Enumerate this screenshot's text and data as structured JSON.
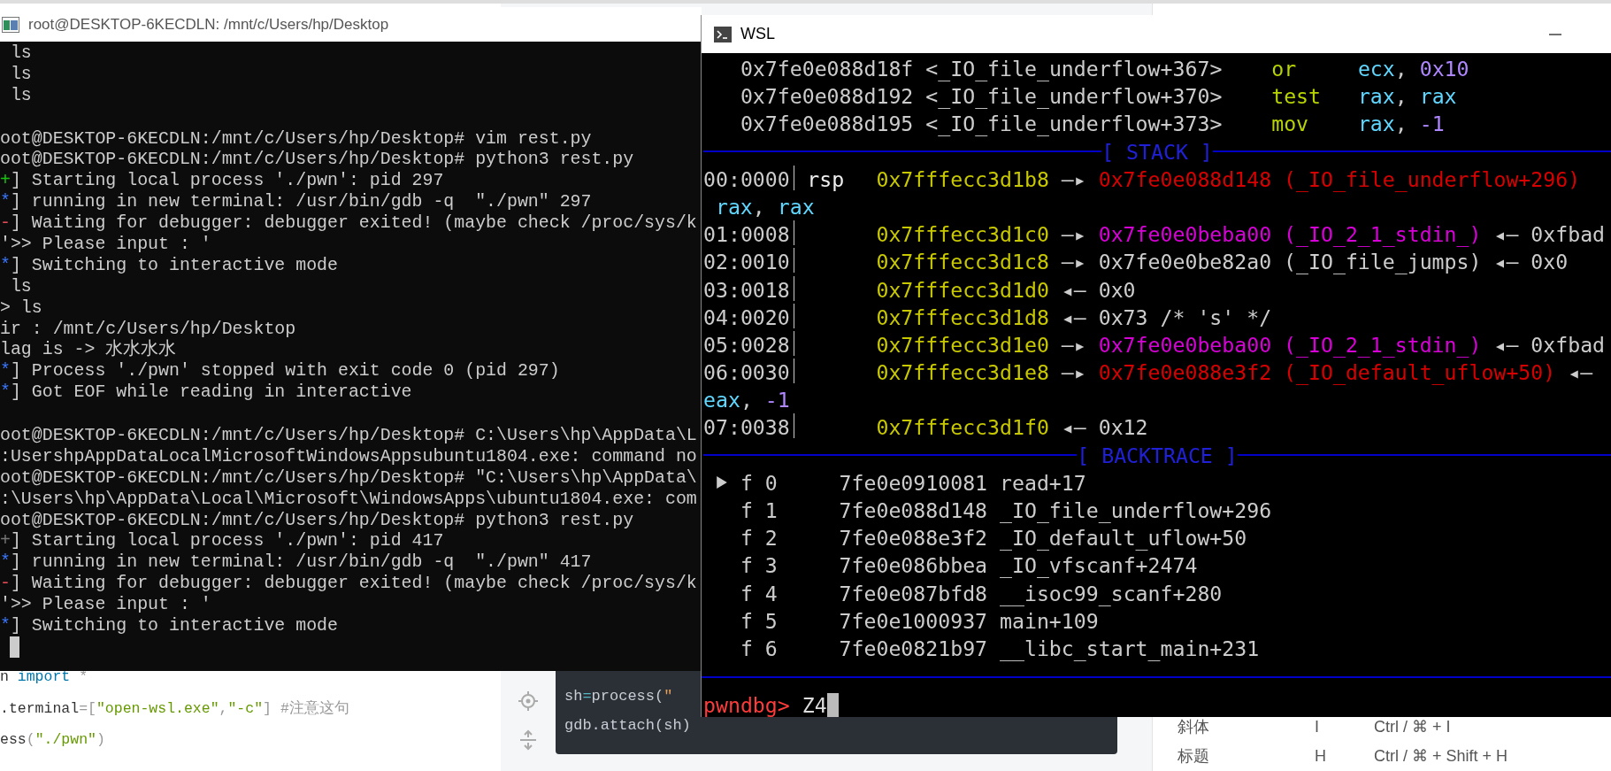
{
  "left_terminal": {
    "title": "root@DESKTOP-6KECDLN: /mnt/c/Users/hp/Desktop",
    "lines": [
      {
        "kind": "plain",
        "text": "ls",
        "indented": true
      },
      {
        "kind": "plain",
        "text": "ls",
        "indented": true
      },
      {
        "kind": "plain",
        "text": "ls",
        "indented": true
      },
      {
        "kind": "plain",
        "text": "oot@DESKTOP-6KECDLN:/mnt/c/Users/hp/Desktop# vim rest.py",
        "gap_before": true
      },
      {
        "kind": "plain",
        "text": "oot@DESKTOP-6KECDLN:/mnt/c/Users/hp/Desktop# python3 rest.py"
      },
      {
        "kind": "success",
        "text": "+] Starting local process './pwn': pid 297"
      },
      {
        "kind": "info",
        "text": "*] running in new terminal: /usr/bin/gdb -q  \"./pwn\" 297"
      },
      {
        "kind": "error",
        "text": "-] Waiting for debugger: debugger exited! (maybe check /proc/sys/k"
      },
      {
        "kind": "plain",
        "text": "'>> Please input : '"
      },
      {
        "kind": "info",
        "text": "*] Switching to interactive mode"
      },
      {
        "kind": "plain",
        "text": "ls",
        "indented": true
      },
      {
        "kind": "plain",
        "text": "> ls"
      },
      {
        "kind": "plain",
        "text": "ir : /mnt/c/Users/hp/Desktop"
      },
      {
        "kind": "plain",
        "text": "lag is -> 水水水水"
      },
      {
        "kind": "info",
        "text": "*] Process './pwn' stopped with exit code 0 (pid 297)"
      },
      {
        "kind": "info",
        "text": "*] Got EOF while reading in interactive"
      },
      {
        "kind": "plain",
        "text": "oot@DESKTOP-6KECDLN:/mnt/c/Users/hp/Desktop# C:\\Users\\hp\\AppData\\L",
        "gap_before": true
      },
      {
        "kind": "plain",
        "text": ":UsershpAppDataLocalMicrosoftWindowsAppsubuntu1804.exe: command no"
      },
      {
        "kind": "plain",
        "text": "oot@DESKTOP-6KECDLN:/mnt/c/Users/hp/Desktop# \"C:\\Users\\hp\\AppData\\"
      },
      {
        "kind": "plain",
        "text": ":\\Users\\hp\\AppData\\Local\\Microsoft\\WindowsApps\\ubuntu1804.exe: com"
      },
      {
        "kind": "plain",
        "text": "oot@DESKTOP-6KECDLN:/mnt/c/Users/hp/Desktop# python3 rest.py"
      },
      {
        "kind": "dim",
        "text": "+] Starting local process './pwn': pid 417"
      },
      {
        "kind": "info",
        "text": "*] running in new terminal: /usr/bin/gdb -q  \"./pwn\" 417"
      },
      {
        "kind": "error",
        "text": "-] Waiting for debugger: debugger exited! (maybe check /proc/sys/k"
      },
      {
        "kind": "plain",
        "text": "'>> Please input : '"
      },
      {
        "kind": "info",
        "text": "*] Switching to interactive mode"
      }
    ]
  },
  "wsl_terminal": {
    "title": "WSL",
    "disassembly": [
      {
        "address": "0x7fe0e088d18f",
        "symbol": "<_IO_file_underflow+367>",
        "mnemonic": "or",
        "operands": [
          {
            "text": "ecx",
            "kind": "register"
          },
          {
            "text": ", ",
            "kind": "plain"
          },
          {
            "text": "0x10",
            "kind": "number"
          }
        ]
      },
      {
        "address": "0x7fe0e088d192",
        "symbol": "<_IO_file_underflow+370>",
        "mnemonic": "test",
        "operands": [
          {
            "text": "rax",
            "kind": "register"
          },
          {
            "text": ", ",
            "kind": "plain"
          },
          {
            "text": "rax",
            "kind": "register"
          }
        ]
      },
      {
        "address": "0x7fe0e088d195",
        "symbol": "<_IO_file_underflow+373>",
        "mnemonic": "mov",
        "operands": [
          {
            "text": "rax",
            "kind": "register"
          },
          {
            "text": ", ",
            "kind": "plain"
          },
          {
            "text": "-1",
            "kind": "number"
          }
        ]
      }
    ],
    "stack_title": "[ STACK ]",
    "stack": [
      {
        "kind": "entry",
        "offset": "00:0000",
        "register": "rsp",
        "address": "0x7fffecc3d1b8",
        "chain": [
          {
            "text": "—▸",
            "kind": "arrow"
          },
          {
            "text": "0x7fe0e088d148 (_IO_file_underflow+296)",
            "kind": "code"
          }
        ]
      },
      {
        "kind": "wrap",
        "indented": true,
        "chain": [
          {
            "text": "rax",
            "kind": "register"
          },
          {
            "text": ", ",
            "kind": "plain"
          },
          {
            "text": "rax",
            "kind": "register"
          }
        ]
      },
      {
        "kind": "entry",
        "offset": "01:0008",
        "address": "0x7fffecc3d1c0",
        "chain": [
          {
            "text": "—▸",
            "kind": "arrow"
          },
          {
            "text": "0x7fe0e0beba00 (_IO_2_1_stdin_)",
            "kind": "data"
          },
          {
            "text": "◂—",
            "kind": "arrow"
          },
          {
            "text": "0xfbad",
            "kind": "plain"
          }
        ]
      },
      {
        "kind": "entry",
        "offset": "02:0010",
        "address": "0x7fffecc3d1c8",
        "chain": [
          {
            "text": "—▸",
            "kind": "arrow"
          },
          {
            "text": "0x7fe0e0be82a0 (_IO_file_jumps)",
            "kind": "plain"
          },
          {
            "text": "◂—",
            "kind": "arrow"
          },
          {
            "text": "0x0",
            "kind": "plain"
          }
        ]
      },
      {
        "kind": "entry",
        "offset": "03:0018",
        "address": "0x7fffecc3d1d0",
        "chain": [
          {
            "text": "◂—",
            "kind": "arrow"
          },
          {
            "text": "0x0",
            "kind": "plain"
          }
        ]
      },
      {
        "kind": "entry",
        "offset": "04:0020",
        "address": "0x7fffecc3d1d8",
        "chain": [
          {
            "text": "◂—",
            "kind": "arrow"
          },
          {
            "text": "0x73 /* 's' */",
            "kind": "plain"
          }
        ]
      },
      {
        "kind": "entry",
        "offset": "05:0028",
        "address": "0x7fffecc3d1e0",
        "chain": [
          {
            "text": "—▸",
            "kind": "arrow"
          },
          {
            "text": "0x7fe0e0beba00 (_IO_2_1_stdin_)",
            "kind": "data"
          },
          {
            "text": "◂—",
            "kind": "arrow"
          },
          {
            "text": "0xfbad",
            "kind": "plain"
          }
        ]
      },
      {
        "kind": "entry",
        "offset": "06:0030",
        "address": "0x7fffecc3d1e8",
        "chain": [
          {
            "text": "—▸",
            "kind": "arrow"
          },
          {
            "text": "0x7fe0e088e3f2 (_IO_default_uflow+50)",
            "kind": "code"
          },
          {
            "text": "◂—",
            "kind": "arrow"
          }
        ]
      },
      {
        "kind": "wrap",
        "indented": false,
        "chain": [
          {
            "text": "eax",
            "kind": "register"
          },
          {
            "text": ", ",
            "kind": "plain"
          },
          {
            "text": "-1",
            "kind": "number"
          }
        ]
      },
      {
        "kind": "entry",
        "offset": "07:0038",
        "address": "0x7fffecc3d1f0",
        "chain": [
          {
            "text": "◂—",
            "kind": "arrow"
          },
          {
            "text": "0x12",
            "kind": "plain"
          }
        ]
      }
    ],
    "backtrace_title": "[ BACKTRACE ]",
    "backtrace": [
      {
        "frame": "f 0",
        "address": "7fe0e0910081",
        "symbol": "read+17",
        "selected": true
      },
      {
        "frame": "f 1",
        "address": "7fe0e088d148",
        "symbol": "_IO_file_underflow+296",
        "selected": false
      },
      {
        "frame": "f 2",
        "address": "7fe0e088e3f2",
        "symbol": "_IO_default_uflow+50",
        "selected": false
      },
      {
        "frame": "f 3",
        "address": "7fe0e086bbea",
        "symbol": "_IO_vfscanf+2474",
        "selected": false
      },
      {
        "frame": "f 4",
        "address": "7fe0e087bfd8",
        "symbol": "__isoc99_scanf+280",
        "selected": false
      },
      {
        "frame": "f 5",
        "address": "7fe0e1000937",
        "symbol": "main+109",
        "selected": false
      },
      {
        "frame": "f 6",
        "address": "7fe0e0821b97",
        "symbol": "__libc_start_main+231",
        "selected": false
      }
    ],
    "prompt": "pwndbg>",
    "command": "Z4"
  },
  "editor": {
    "code_lines": [
      [
        {
          "text": "n ",
          "kind": "plain"
        },
        {
          "text": "import",
          "kind": "keyword"
        },
        {
          "text": " *",
          "kind": "punct"
        }
      ],
      [
        {
          "text": ".terminal",
          "kind": "plain"
        },
        {
          "text": "=[",
          "kind": "punct"
        },
        {
          "text": "\"open-wsl.exe\"",
          "kind": "string"
        },
        {
          "text": ",",
          "kind": "punct"
        },
        {
          "text": "\"-c\"",
          "kind": "string"
        },
        {
          "text": "] ",
          "kind": "punct"
        },
        {
          "text": "#注意这句",
          "kind": "comment"
        }
      ],
      [
        {
          "text": "ess",
          "kind": "plain"
        },
        {
          "text": "(",
          "kind": "punct"
        },
        {
          "text": "\"./pwn\"",
          "kind": "string"
        },
        {
          "text": ")",
          "kind": "punct"
        }
      ]
    ],
    "code_block": [
      [
        {
          "text": "sh",
          "kind": "plain"
        },
        {
          "text": "=",
          "kind": "operator"
        },
        {
          "text": "process(",
          "kind": "plain"
        },
        {
          "text": "\"",
          "kind": "string"
        }
      ],
      [
        {
          "text": "gdb.attach(sh)",
          "kind": "plain"
        }
      ]
    ],
    "shortcuts": [
      {
        "name": "斜体",
        "key": "I",
        "combo": "Ctrl / ⌘ + I"
      },
      {
        "name": "标题",
        "key": "H",
        "combo": "Ctrl / ⌘ + Shift + H"
      }
    ]
  }
}
